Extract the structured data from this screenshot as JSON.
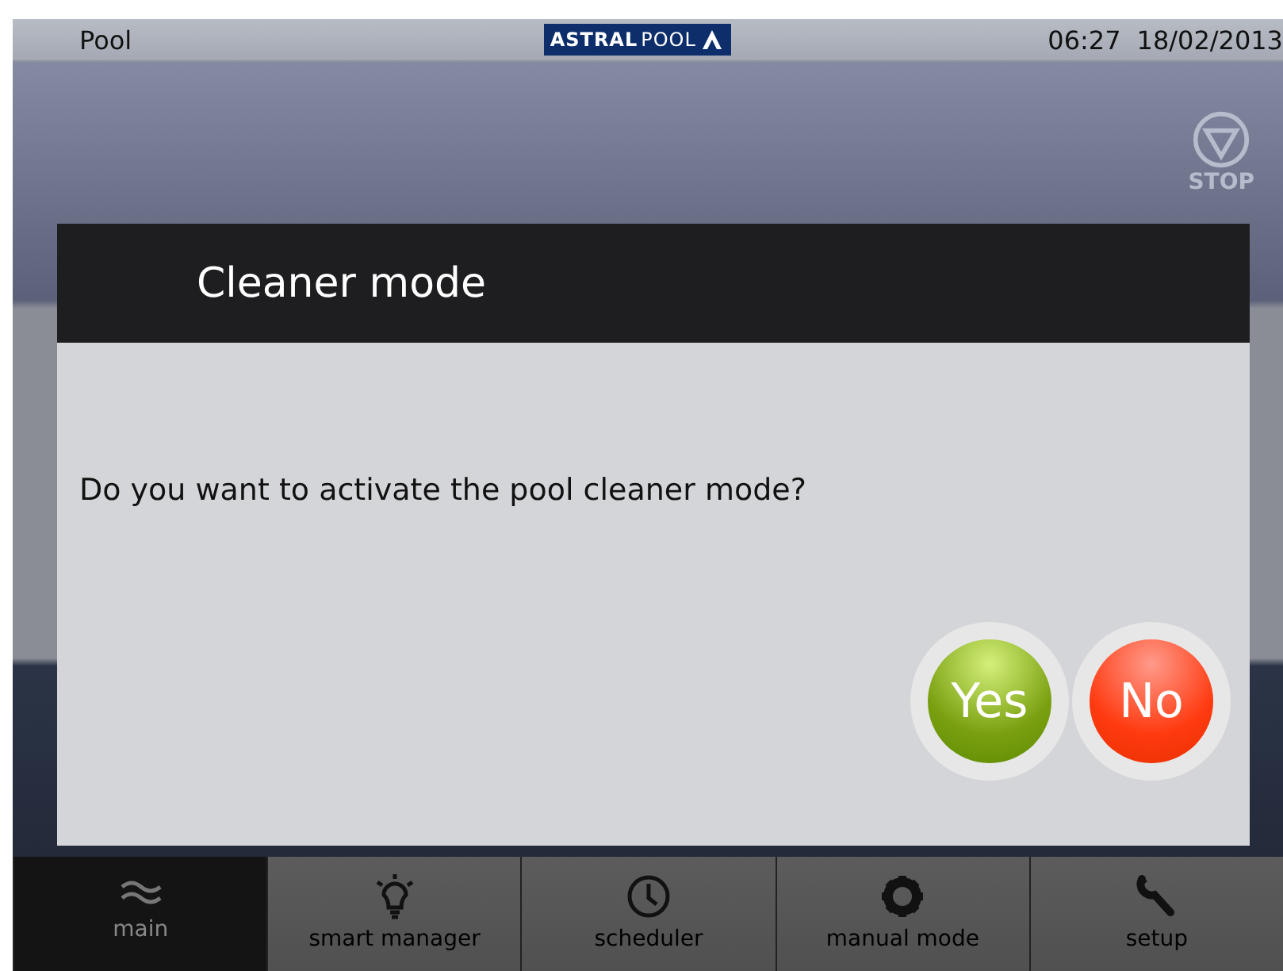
{
  "status_bar": {
    "title": "Pool",
    "logo_bold": "ASTRAL",
    "logo_light": "POOL",
    "time": "06:27",
    "date": "18/02/2013"
  },
  "stop": {
    "label": "STOP"
  },
  "dialog": {
    "title": "Cleaner mode",
    "message": "Do you want to activate the pool cleaner mode?",
    "buttons": [
      {
        "label": "Yes",
        "kind": "confirm"
      },
      {
        "label": "No",
        "kind": "cancel"
      }
    ]
  },
  "nav": [
    {
      "label": "main",
      "selected": true
    },
    {
      "label": "smart manager",
      "selected": false
    },
    {
      "label": "scheduler",
      "selected": false
    },
    {
      "label": "manual mode",
      "selected": false
    },
    {
      "label": "setup",
      "selected": false
    }
  ]
}
